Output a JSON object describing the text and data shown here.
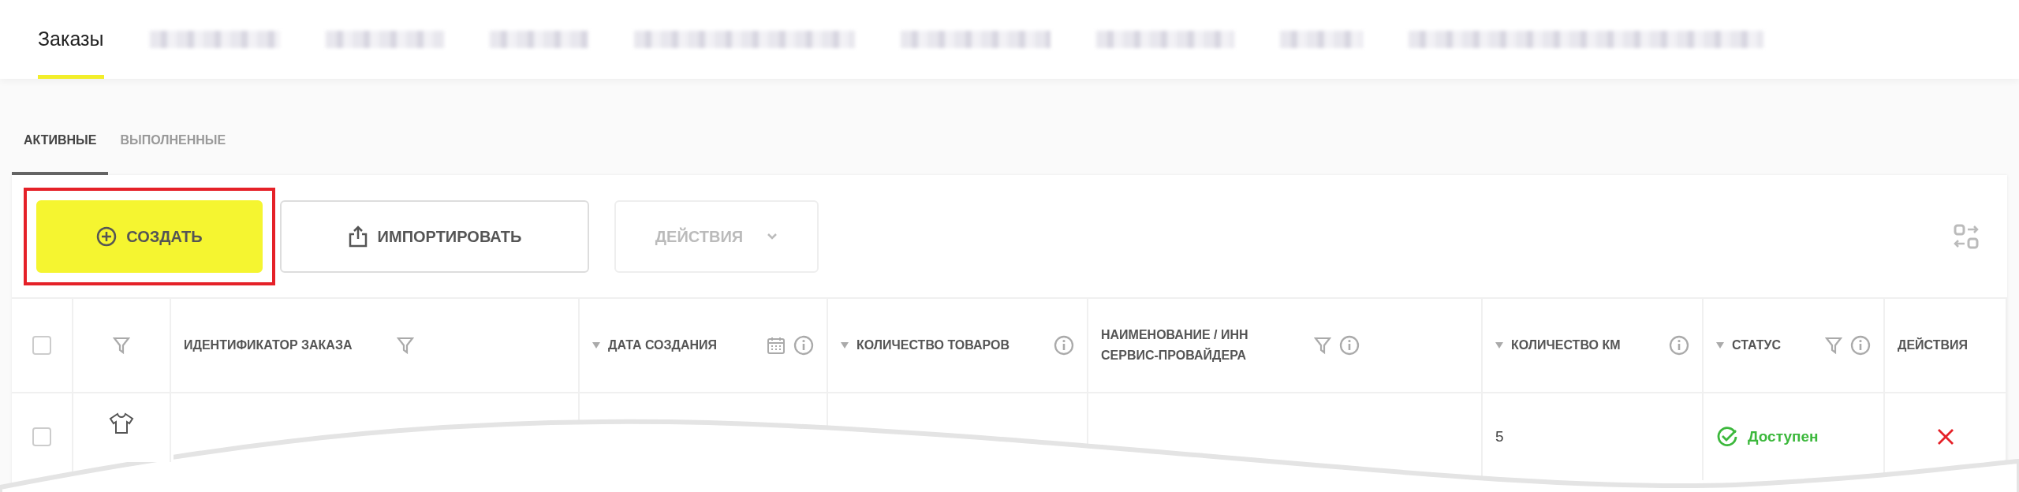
{
  "tabs": [
    {
      "label": "Заказы",
      "selected": true
    },
    {
      "kind": "blurred",
      "selected": false
    },
    {
      "kind": "blurred",
      "selected": false
    },
    {
      "kind": "blurred",
      "selected": false
    },
    {
      "kind": "blurred",
      "selected": false
    },
    {
      "kind": "blurred",
      "selected": false
    },
    {
      "kind": "blurred",
      "selected": false
    },
    {
      "kind": "blurred",
      "selected": false
    },
    {
      "kind": "blurred",
      "selected": false
    }
  ],
  "subtabs": [
    {
      "label": "АКТИВНЫЕ",
      "selected": true
    },
    {
      "label": "ВЫПОЛНЕННЫЕ",
      "selected": false
    }
  ],
  "toolbar": {
    "buttons": [
      {
        "kind": "create",
        "label": "СОЗДАТЬ",
        "disabled": false,
        "highlighted": true
      },
      {
        "kind": "import",
        "label": "ИМПОРТИРОВАТЬ",
        "disabled": false,
        "highlighted": false
      },
      {
        "kind": "dropdown",
        "label": "ДЕЙСТВИЯ",
        "disabled": true,
        "highlighted": false
      }
    ]
  },
  "table": {
    "columns": [
      {
        "kind": "check"
      },
      {
        "kind": "filter-only"
      },
      {
        "label": "ИДЕНТИФИКАТОР ЗАКАЗА",
        "sort": false,
        "filter": true,
        "calendar": false,
        "info": false
      },
      {
        "label": "ДАТА СОЗДАНИЯ",
        "sort": true,
        "filter": false,
        "calendar": true,
        "info": true
      },
      {
        "label": "КОЛИЧЕСТВО ТОВАРОВ",
        "sort": true,
        "filter": false,
        "calendar": false,
        "info": true
      },
      {
        "label": "НАИМЕНОВАНИЕ / ИНН СЕРВИС-ПРОВАЙДЕРА",
        "sort": false,
        "filter": true,
        "calendar": false,
        "info": true
      },
      {
        "label": "КОЛИЧЕСТВО КМ",
        "sort": true,
        "filter": false,
        "calendar": false,
        "info": true
      },
      {
        "label": "СТАТУС",
        "sort": true,
        "filter": true,
        "calendar": false,
        "info": true
      },
      {
        "label": "ДЕЙСТВИЯ",
        "sort": false,
        "filter": false,
        "calendar": false,
        "info": false
      }
    ],
    "select_all_checked": false,
    "rows": [
      {
        "checked": false,
        "km": "5",
        "status": {
          "label": "Доступен",
          "kind": "ok"
        }
      }
    ]
  }
}
